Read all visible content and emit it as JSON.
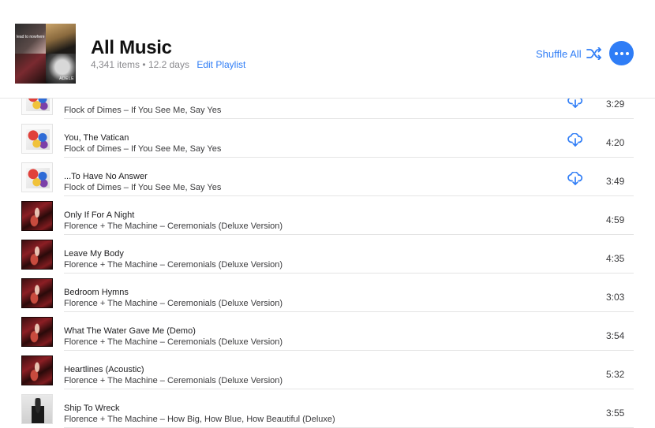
{
  "playlist": {
    "title": "All Music",
    "items": "4,341 items",
    "bullet": "•",
    "duration": "12.2 days",
    "edit_label": "Edit Playlist",
    "shuffle_label": "Shuffle All",
    "artwork_texts": [
      "lead to nowhere",
      "ADELE"
    ]
  },
  "accent_color": "#2f7df6",
  "tracks": [
    {
      "title": "",
      "subtitle": "Flock of Dimes – If You See Me, Say Yes",
      "duration": "3:29",
      "download": true,
      "art": "flock"
    },
    {
      "title": "You, The Vatican",
      "subtitle": "Flock of Dimes – If You See Me, Say Yes",
      "duration": "4:20",
      "download": true,
      "art": "flock"
    },
    {
      "title": "...To Have No Answer",
      "subtitle": "Flock of Dimes – If You See Me, Say Yes",
      "duration": "3:49",
      "download": true,
      "art": "flock"
    },
    {
      "title": "Only If For A Night",
      "subtitle": "Florence + The Machine – Ceremonials (Deluxe Version)",
      "duration": "4:59",
      "download": false,
      "art": "florence"
    },
    {
      "title": "Leave My Body",
      "subtitle": "Florence + The Machine – Ceremonials (Deluxe Version)",
      "duration": "4:35",
      "download": false,
      "art": "florence"
    },
    {
      "title": "Bedroom Hymns",
      "subtitle": "Florence + The Machine – Ceremonials (Deluxe Version)",
      "duration": "3:03",
      "download": false,
      "art": "florence"
    },
    {
      "title": "What The Water Gave Me (Demo)",
      "subtitle": "Florence + The Machine – Ceremonials (Deluxe Version)",
      "duration": "3:54",
      "download": false,
      "art": "florence"
    },
    {
      "title": "Heartlines (Acoustic)",
      "subtitle": "Florence + The Machine – Ceremonials (Deluxe Version)",
      "duration": "5:32",
      "download": false,
      "art": "florence"
    },
    {
      "title": "Ship To Wreck",
      "subtitle": "Florence + The Machine – How Big, How Blue, How Beautiful (Deluxe)",
      "duration": "3:55",
      "download": false,
      "art": "ship"
    }
  ]
}
